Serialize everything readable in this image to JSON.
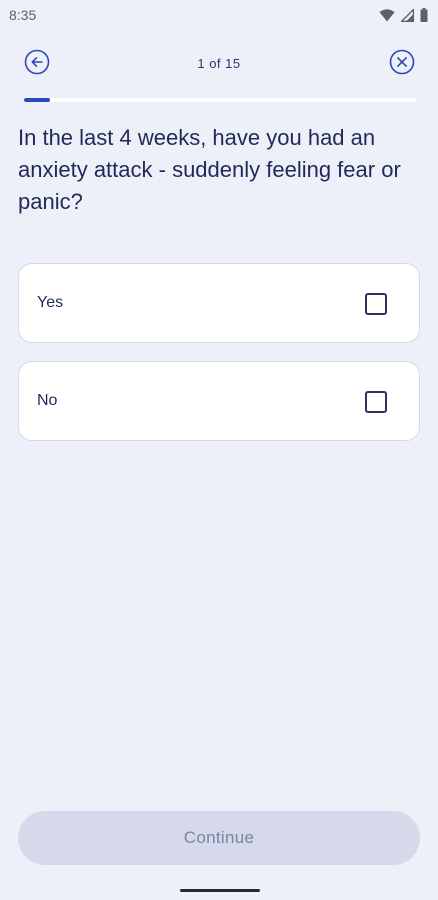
{
  "status_bar": {
    "time": "8:35",
    "icons": [
      "wifi-icon",
      "cell-signal-icon",
      "battery-icon"
    ]
  },
  "header": {
    "step_counter": "1 of 15",
    "back_icon": "arrow-left-circle-icon",
    "close_icon": "close-circle-icon"
  },
  "progress": {
    "current": 1,
    "total": 15,
    "fraction": 0.0667
  },
  "question": {
    "text": "In the last 4 weeks, have you had an anxiety attack - suddenly feeling fear or panic?"
  },
  "options": [
    {
      "label": "Yes",
      "checked": false
    },
    {
      "label": "No",
      "checked": false
    }
  ],
  "continue_label": "Continue",
  "colors": {
    "background": "#eef0f9",
    "accent": "#2f46b8",
    "text": "#1f2a5a",
    "button_disabled_bg": "#d5d9ea",
    "button_disabled_text": "#7b84a8"
  }
}
